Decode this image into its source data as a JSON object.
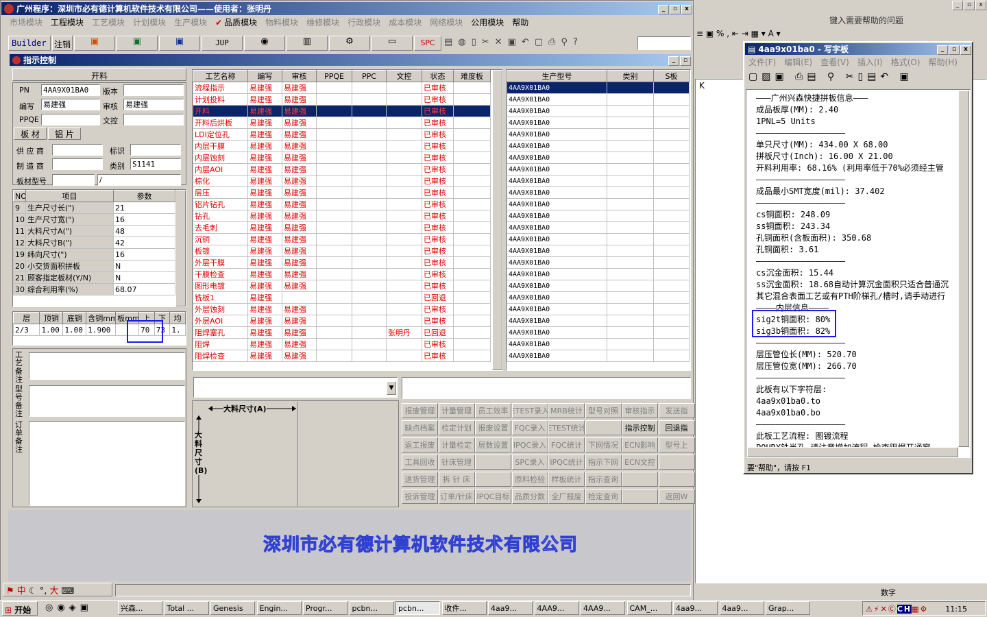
{
  "app": {
    "title": "广州程序：深圳市必有德计算机软件技术有限公司——使用者：张明丹",
    "footer_company": "深圳市必有德计算机软件技术有限公司"
  },
  "menu": [
    "市场模块",
    "工程模块",
    "工艺模块",
    "计划模块",
    "生产模块",
    "品质模块",
    "物料模块",
    "维修模块",
    "行政模块",
    "成本模块",
    "网络模块",
    "公用模块",
    "帮助"
  ],
  "toolbar": {
    "builder": "Builder",
    "cancel": "注销",
    "jup": "JUP",
    "spc": "SPC"
  },
  "panel": {
    "title": "指示控制",
    "tab_open": "开料",
    "fields": {
      "pn_label": "PN",
      "pn": "4AA9X01BA0",
      "version_label": "版本",
      "editor_label": "编写",
      "editor": "易建强",
      "review_label": "审核",
      "reviewer": "易建强",
      "ppqe_label": "PPQE",
      "doc_label": "文控"
    },
    "subtabs": [
      "板 材",
      "铝 片"
    ],
    "material": {
      "supplier_label": "供 应 商",
      "mark_label": "标识",
      "maker_label": "制 造 商",
      "type_label": "类别",
      "type": "S1141",
      "model_label": "板材型号",
      "model": "/"
    }
  },
  "params": {
    "headers": [
      "NO",
      "项目",
      "参数"
    ],
    "rows": [
      [
        "9",
        "生产尺寸长(\")",
        "21"
      ],
      [
        "10",
        "生产尺寸宽(\")",
        "16"
      ],
      [
        "11",
        "大料尺寸A(\")",
        "48"
      ],
      [
        "12",
        "大料尺寸B(\")",
        "42"
      ],
      [
        "19",
        "纬向尺寸(\")",
        "16"
      ],
      [
        "20",
        "小交货面积拼板",
        "N"
      ],
      [
        "21",
        "顾客指定板材(Y/N)",
        "N"
      ],
      [
        "30",
        "综合利用率(%)",
        "68.07"
      ]
    ]
  },
  "layers": {
    "headers": [
      "层",
      "顶铜",
      "底铜",
      "含铜mm",
      "板mm",
      "上",
      "下",
      "均"
    ],
    "row": [
      "2/3",
      "1.00",
      "1.00",
      "1.900",
      "",
      "70",
      "73",
      "1."
    ]
  },
  "notes": [
    "工艺备注",
    "型号备注",
    "订单备注"
  ],
  "process": {
    "headers": [
      "工艺名称",
      "编写",
      "审核",
      "PPQE",
      "PPC",
      "文控",
      "状态",
      "难度板"
    ],
    "rows": [
      [
        "流程指示",
        "易建强",
        "易建强",
        "",
        "",
        "",
        "已审核"
      ],
      [
        "计划投料",
        "易建强",
        "易建强",
        "",
        "",
        "",
        "已审核"
      ],
      [
        "开料",
        "易建强",
        "易建强",
        "",
        "",
        "",
        "已审核"
      ],
      [
        "开料后烘板",
        "易建强",
        "易建强",
        "",
        "",
        "",
        "已审核"
      ],
      [
        "LDI定位孔",
        "易建强",
        "易建强",
        "",
        "",
        "",
        "已审核"
      ],
      [
        "内层干膜",
        "易建强",
        "易建强",
        "",
        "",
        "",
        "已审核"
      ],
      [
        "内层蚀刻",
        "易建强",
        "易建强",
        "",
        "",
        "",
        "已审核"
      ],
      [
        "内层AOI",
        "易建强",
        "易建强",
        "",
        "",
        "",
        "已审核"
      ],
      [
        "棕化",
        "易建强",
        "易建强",
        "",
        "",
        "",
        "已审核"
      ],
      [
        "层压",
        "易建强",
        "易建强",
        "",
        "",
        "",
        "已审核"
      ],
      [
        "铝片钻孔",
        "易建强",
        "易建强",
        "",
        "",
        "",
        "已审核"
      ],
      [
        "钻孔",
        "易建强",
        "易建强",
        "",
        "",
        "",
        "已审核"
      ],
      [
        "去毛刺",
        "易建强",
        "易建强",
        "",
        "",
        "",
        "已审核"
      ],
      [
        "沉铜",
        "易建强",
        "易建强",
        "",
        "",
        "",
        "已审核"
      ],
      [
        "板镀",
        "易建强",
        "易建强",
        "",
        "",
        "",
        "已审核"
      ],
      [
        "外层干膜",
        "易建强",
        "易建强",
        "",
        "",
        "",
        "已审核"
      ],
      [
        "干膜检查",
        "易建强",
        "易建强",
        "",
        "",
        "",
        "已审核"
      ],
      [
        "图形电镀",
        "易建强",
        "易建强",
        "",
        "",
        "",
        "已审核"
      ],
      [
        "铣板1",
        "易建强",
        "",
        "",
        "",
        "",
        "已回退"
      ],
      [
        "外层蚀刻",
        "易建强",
        "易建强",
        "",
        "",
        "",
        "已审核"
      ],
      [
        "外层AOI",
        "易建强",
        "易建强",
        "",
        "",
        "",
        "已审核"
      ],
      [
        "阻焊塞孔",
        "易建强",
        "易建强",
        "",
        "",
        "张明丹",
        "已回退"
      ],
      [
        "阻焊",
        "易建强",
        "易建强",
        "",
        "",
        "",
        "已审核"
      ],
      [
        "阻焊检查",
        "易建强",
        "易建强",
        "",
        "",
        "",
        "已审核"
      ]
    ]
  },
  "models": {
    "headers": [
      "生产型号",
      "类别",
      "S板"
    ],
    "value": "4AA9X01BA0",
    "count": 24
  },
  "diagram": {
    "a_label": "大料尺寸(A)",
    "b_label": "大料尺寸(B)"
  },
  "buttons": [
    [
      "报废管理",
      "计量管理",
      "员工效率",
      "ETEST录入",
      "MRB统计",
      "型号对照",
      "审核指示",
      "发送指"
    ],
    [
      "缺点档案",
      "检定计划",
      "报废设置",
      "FQC录入",
      "ETEST统计",
      "",
      "指示控制",
      "回退指"
    ],
    [
      "返工报废",
      "计量检定",
      "层数设置",
      "IPQC录入",
      "FQC统计",
      "下网情况",
      "ECN影响",
      "型号上"
    ],
    [
      "工具回收",
      "针床管理",
      "",
      "SPC录入",
      "IPQC统计",
      "指示下网",
      "ECN文控",
      ""
    ],
    [
      "退货管理",
      "拆 针 床",
      "",
      "原料检验",
      "样板统计",
      "指示查询",
      "",
      ""
    ],
    [
      "投诉管理",
      "订单/针床",
      "IPQC目标",
      "品质分数",
      "全厂报废",
      "检定查询",
      "",
      "返回W"
    ]
  ],
  "ime": "中",
  "wordpad": {
    "title": "4aa9x01ba0 - 写字板",
    "menu": [
      "文件(F)",
      "编辑(E)",
      "查看(V)",
      "插入(I)",
      "格式(O)",
      "帮助(H)"
    ],
    "status": "要\"帮助\"，请按 F1",
    "lines": [
      "———广州兴森快捷拼板信息———",
      "成品板厚(MM): 2.40",
      "1PNL=5 Units",
      "——————————————————",
      "单只尺寸(MM): 434.00 X 68.00",
      "拼板尺寸(Inch): 16.00 X 21.00",
      "开料利用率: 68.16% (利用率低于70%必须经主管",
      "——————————————————",
      "成品最小SMT宽度(mil): 37.402",
      "——————————————————",
      "cs铜面积: 248.09",
      "ss铜面积: 243.34",
      "孔铜面积(含板面积): 350.68",
      "孔铜面积: 3.61",
      "——————————————————",
      "cs沉金面积: 15.44",
      "ss沉金面积: 18.68自动计算沉金面积只适合普通沉",
      "其它混合表面工艺或有PTH阶梯孔/槽时,请手动进行",
      "————内层信息————",
      "sig2t铜面积: 80%",
      "sig3b铜面积: 82%",
      "——————————————————",
      "层压管位长(MM): 520.70",
      "层压管位宽(MM): 266.70",
      "——————————————————",
      "此板有以下字符层:",
      "4aa9x01ba0.to",
      "4aa9x01ba0.bo",
      "——————————————————",
      "此板工艺流程: 图镀流程",
      "POURX铣半孔 请注意增加流程 检查阻焊开通窗"
    ]
  },
  "excel": {
    "help_placeholder": "键入需要帮助的问题",
    "col": "K",
    "status": "数字"
  },
  "taskbar": {
    "start": "开始",
    "clock": "11:15",
    "items": [
      "兴森...",
      "Total ...",
      "Genesis",
      "Engin...",
      "Progr...",
      "pcbn...",
      "pcbn...",
      "收件...",
      "4aa9...",
      "4AA9...",
      "4AA9...",
      "CAM_...",
      "4aa9...",
      "4aa9...",
      "Grap..."
    ]
  }
}
